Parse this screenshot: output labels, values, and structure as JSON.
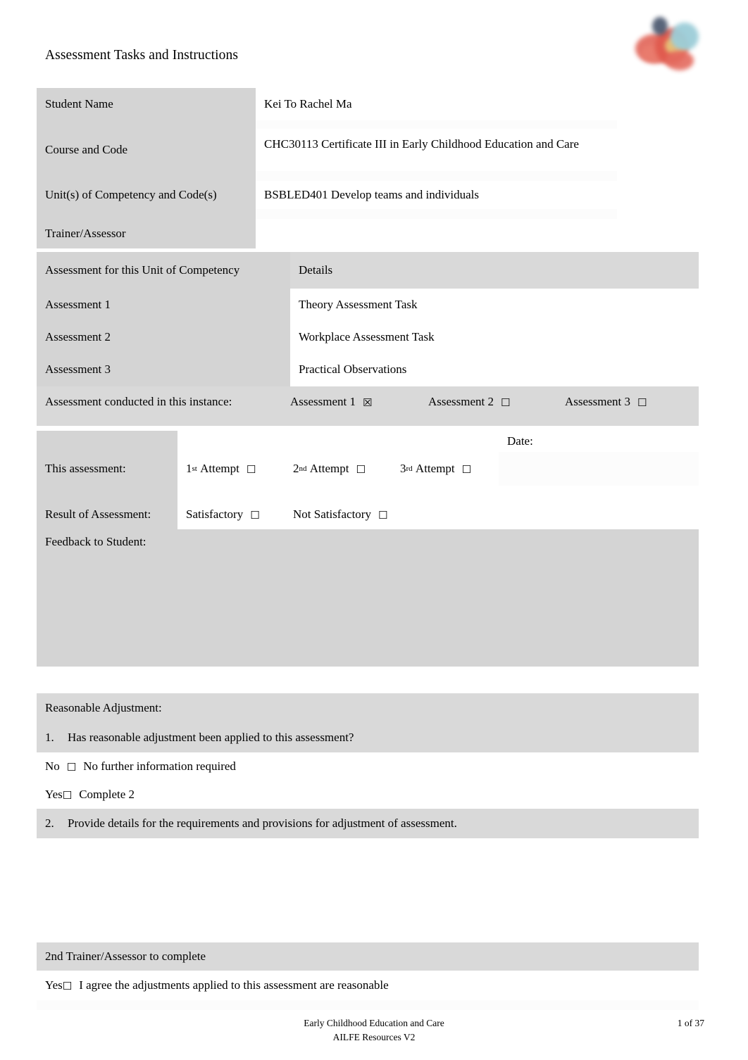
{
  "document": {
    "title": "Assessment Tasks and Instructions",
    "logo_alt": "ailfe-logo"
  },
  "student_table": {
    "rows": [
      {
        "label": "Student Name",
        "value": "Kei To Rachel Ma"
      },
      {
        "label": "Course and Code",
        "value": "CHC30113 Certificate III in Early Childhood Education and Care"
      },
      {
        "label": "Unit(s) of Competency and Code(s)",
        "value": "BSBLED401 Develop teams and individuals"
      },
      {
        "label": "Trainer/Assessor",
        "value": ""
      }
    ]
  },
  "assessment_table": {
    "header": {
      "label": "Assessment for this Unit of Competency",
      "value": "Details"
    },
    "rows": [
      {
        "label": "Assessment 1",
        "value": "Theory Assessment Task"
      },
      {
        "label": "Assessment 2",
        "value": "Workplace Assessment Task"
      },
      {
        "label": "Assessment 3",
        "value": "Practical Observations"
      }
    ],
    "conducted_label": "Assessment conducted in this instance:",
    "conducted_options": [
      {
        "label": "Assessment 1",
        "checkbox": "☒",
        "checked": true
      },
      {
        "label": "Assessment 2",
        "checkbox": "☐",
        "checked": false
      },
      {
        "label": "Assessment 3",
        "checkbox": "☐",
        "checked": false
      }
    ]
  },
  "result_table": {
    "this_assessment_label": "This assessment:",
    "attempts": [
      {
        "ordinal": "1",
        "sup": "st",
        "label": "Attempt",
        "checkbox": "☐"
      },
      {
        "ordinal": "2",
        "sup": "nd",
        "label": "Attempt",
        "checkbox": "☐"
      },
      {
        "ordinal": "3",
        "sup": "rd",
        "label": "Attempt",
        "checkbox": "☐"
      }
    ],
    "date_label": "Date:",
    "date_value": "",
    "result_label": "Result of Assessment:",
    "result_options": [
      {
        "label": "Satisfactory",
        "checkbox": "☐"
      },
      {
        "label": "Not Satisfactory",
        "checkbox": "☐"
      }
    ],
    "feedback_label": "Feedback to Student:",
    "feedback_value": ""
  },
  "reasonable_adjustment": {
    "heading": "Reasonable Adjustment:",
    "question_1_num": "1.",
    "question_1": "Has reasonable adjustment been applied to this assessment?",
    "answer_no": {
      "prefix": "No",
      "checkbox": "☐",
      "text": "No further information required"
    },
    "answer_yes": {
      "prefix": "Yes",
      "checkbox": "☐",
      "text": "Complete 2"
    },
    "question_2_num": "2.",
    "question_2": "Provide details for the requirements and provisions for adjustment of assessment.",
    "details_value": "",
    "second_assessor_heading": "2nd Trainer/Assessor to complete",
    "second_assessor_agree": {
      "prefix": "Yes",
      "checkbox": "☐",
      "text": "I agree the adjustments applied to this assessment are reasonable"
    }
  },
  "footer": {
    "line1": "Early Childhood Education and Care",
    "line2": "AILFE Resources V2",
    "page": "1 of 37"
  }
}
